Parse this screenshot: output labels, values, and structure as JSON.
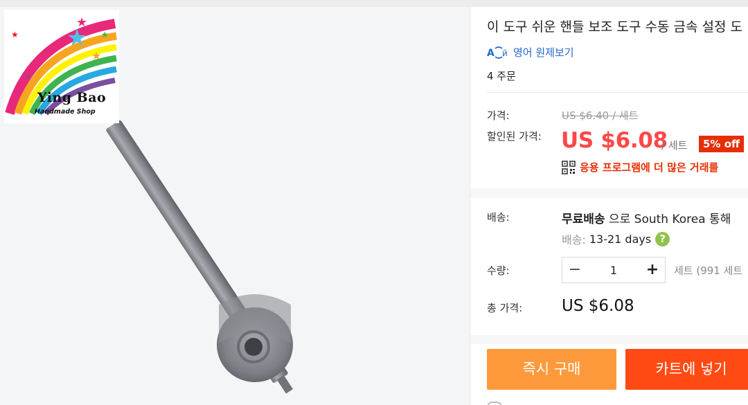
{
  "product": {
    "title": "이 도구 쉬운 핸들 보조 도구 수동 금속 설정 도",
    "translate_link": "영어 원제보기",
    "translate_icon": "translate-icon",
    "orders": "4 주문"
  },
  "store_logo": {
    "brand": "Ying Bao",
    "subtitle": "Handmade Shop"
  },
  "price": {
    "label": "가격:",
    "original": "US $6.40 / 세트",
    "discount_label": "할인된 가격:",
    "sale": "US $6.08",
    "unit": "/ 세트",
    "badge": "5% off",
    "app_deal": "응용 프로그램에 더 많은 거래를"
  },
  "shipping": {
    "label": "배송:",
    "method": "무료배송",
    "via": "으로 South Korea 통해",
    "days_label": "배송:",
    "days": "13-21 days",
    "help": "?"
  },
  "quantity": {
    "label": "수량:",
    "minus": "−",
    "value": "1",
    "plus": "+",
    "stock": "세트 (991 세트"
  },
  "total": {
    "label": "총 가격:",
    "value": "US $6.08"
  },
  "actions": {
    "buy_now": "즉시 구매",
    "add_to_cart": "카트에 넣기"
  },
  "colors": {
    "sale_red": "#ff4747",
    "badge_red": "#e62e04",
    "buy_orange": "#ff9a3c",
    "cart_orange": "#ff4a14",
    "link_blue": "#2469c9"
  }
}
